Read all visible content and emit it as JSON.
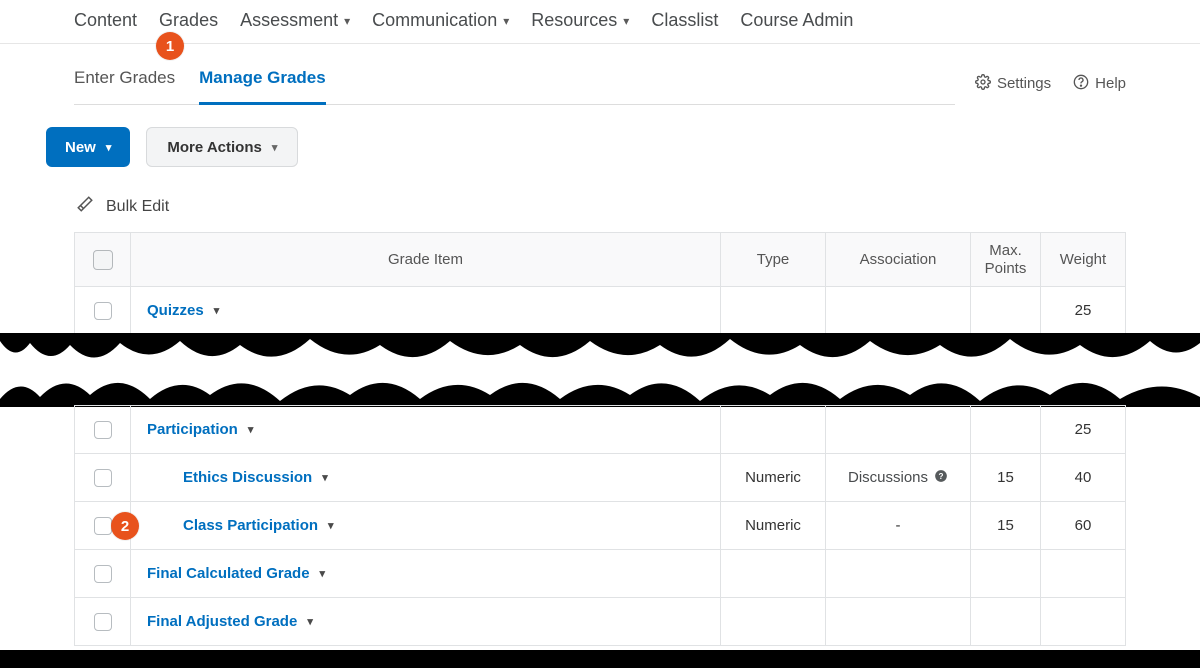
{
  "topnav": {
    "content": "Content",
    "grades": "Grades",
    "assessment": "Assessment",
    "communication": "Communication",
    "resources": "Resources",
    "classlist": "Classlist",
    "course_admin": "Course Admin"
  },
  "subtabs": {
    "enter": "Enter Grades",
    "manage": "Manage Grades"
  },
  "toolbar_links": {
    "settings": "Settings",
    "help": "Help"
  },
  "buttons": {
    "new": "New",
    "more_actions": "More Actions",
    "bulk_edit": "Bulk Edit"
  },
  "columns": {
    "grade_item": "Grade Item",
    "type": "Type",
    "association": "Association",
    "max_points": "Max. Points",
    "weight": "Weight"
  },
  "rows": {
    "quizzes": {
      "label": "Quizzes",
      "type": "",
      "association": "",
      "points": "",
      "weight": "25"
    },
    "participation": {
      "label": "Participation",
      "type": "",
      "association": "",
      "points": "",
      "weight": "25"
    },
    "ethics": {
      "label": "Ethics Discussion",
      "type": "Numeric",
      "association": "Discussions",
      "points": "15",
      "weight": "40"
    },
    "class_part": {
      "label": "Class Participation",
      "type": "Numeric",
      "association": "-",
      "points": "15",
      "weight": "60"
    },
    "final_calc": {
      "label": "Final Calculated Grade",
      "type": "",
      "association": "",
      "points": "",
      "weight": ""
    },
    "final_adj": {
      "label": "Final Adjusted Grade",
      "type": "",
      "association": "",
      "points": "",
      "weight": ""
    }
  },
  "callouts": {
    "one": "1",
    "two": "2"
  }
}
